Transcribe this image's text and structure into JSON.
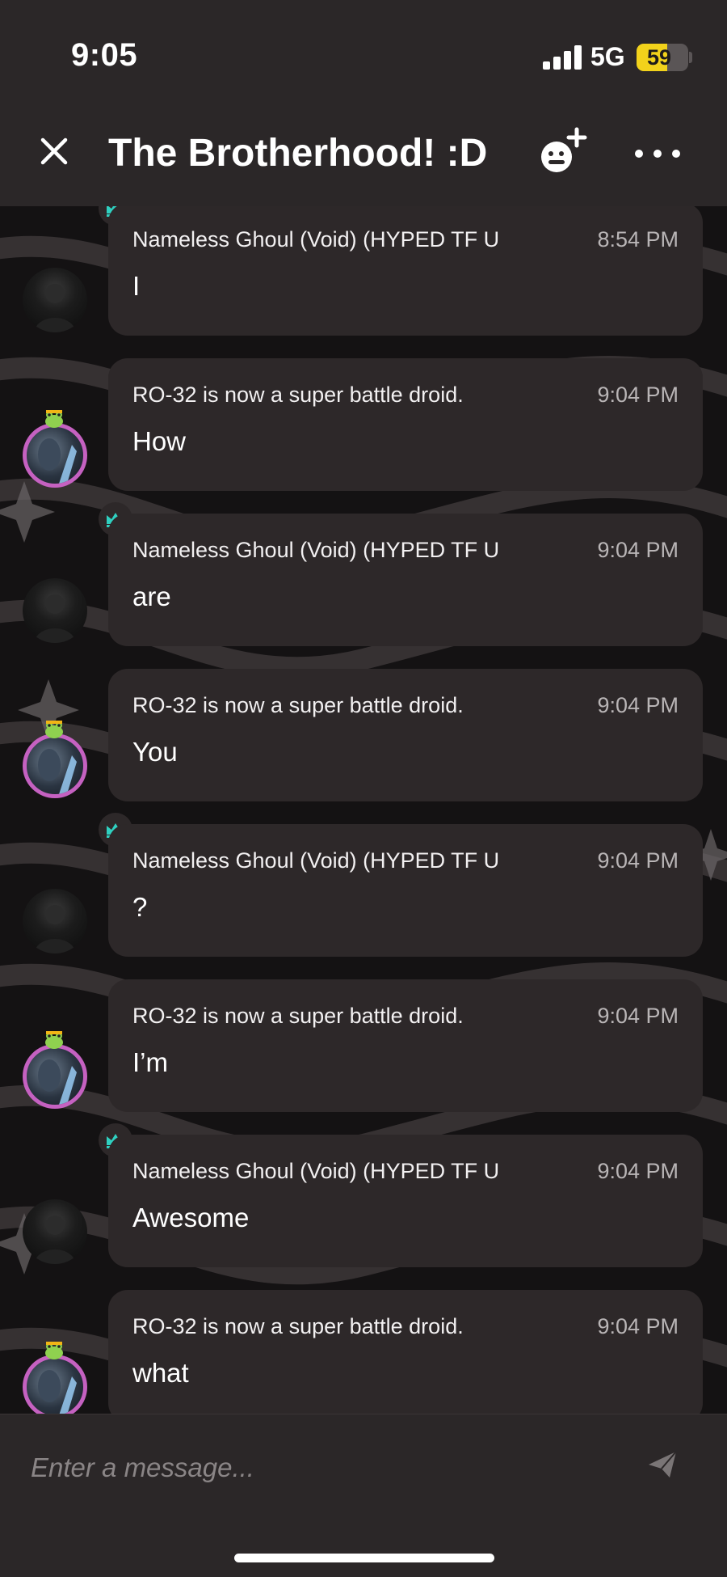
{
  "status_bar": {
    "time": "9:05",
    "network": "5G",
    "battery": "59",
    "battery_level_percent": 59
  },
  "header": {
    "title": "The Brotherhood! :D"
  },
  "messages": [
    {
      "sender": "Nameless Ghoul (Void) (HYPED TF U",
      "time": "8:54 PM",
      "text": "I",
      "avatar": "ghoul",
      "crown": true
    },
    {
      "sender": "RO-32 is now a super battle droid.",
      "time": "9:04 PM",
      "text": "How",
      "avatar": "droid",
      "crown": false
    },
    {
      "sender": "Nameless Ghoul (Void) (HYPED TF U",
      "time": "9:04 PM",
      "text": "are",
      "avatar": "ghoul",
      "crown": true
    },
    {
      "sender": "RO-32 is now a super battle droid.",
      "time": "9:04 PM",
      "text": "You",
      "avatar": "droid",
      "crown": false
    },
    {
      "sender": "Nameless Ghoul (Void) (HYPED TF U",
      "time": "9:04 PM",
      "text": "?",
      "avatar": "ghoul",
      "crown": true
    },
    {
      "sender": "RO-32 is now a super battle droid.",
      "time": "9:04 PM",
      "text": "I’m",
      "avatar": "droid",
      "crown": false
    },
    {
      "sender": "Nameless Ghoul (Void) (HYPED TF U",
      "time": "9:04 PM",
      "text": "Awesome",
      "avatar": "ghoul",
      "crown": true
    },
    {
      "sender": "RO-32 is now a super battle droid.",
      "time": "9:04 PM",
      "text": "what",
      "avatar": "droid",
      "crown": false
    }
  ],
  "composer": {
    "placeholder": "Enter a message..."
  },
  "icons": {
    "close": "close-icon",
    "add_member": "add-member-icon",
    "more": "more-options-icon",
    "crown": "crown-icon",
    "send": "send-icon"
  },
  "colors": {
    "background": "#2b2728",
    "bubble": "#2d2829",
    "crown": "#2fd0c0",
    "droid_ring": "#c561c1",
    "battery": "#f2d21b"
  }
}
